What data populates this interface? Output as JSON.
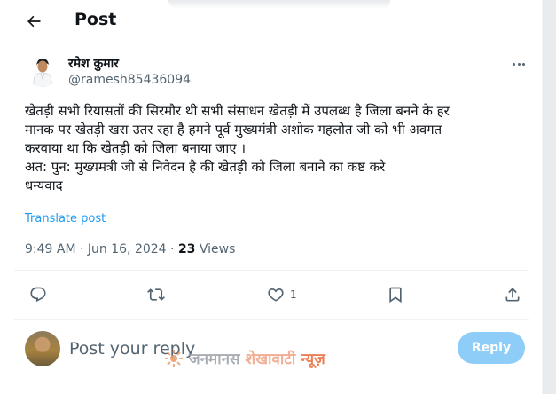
{
  "header": {
    "title": "Post",
    "back_icon": "arrow-left-icon"
  },
  "author": {
    "name": "रमेश कुमार",
    "handle": "@ramesh85436094",
    "avatar_icon": "user-avatar"
  },
  "post": {
    "lines": [
      "खेतड़ी सभी रियासतों की सिरमौर थी सभी संसाधन खेतड़ी में उपलब्ध है जिला बनने के हर",
      "मानक पर खेतड़ी खरा उतर रहा है हमने पूर्व मुख्यमंत्री अशोक गहलोत जी को भी अवगत",
      "करवाया था कि खेतड़ी को जिला बनाया जाए ।",
      "अत: पुन: मुख्यमत्री जी से निवेदन है की खेतड़ी को जिला बनाने का कष्ट करे",
      "धन्यवाद"
    ],
    "translate_label": "Translate post",
    "time": "9:49 AM",
    "date": "Jun 16, 2024",
    "views_count": "23",
    "views_label": "Views"
  },
  "actions": {
    "reply_icon": "reply-icon",
    "repost_icon": "repost-icon",
    "like_icon": "heart-icon",
    "like_count": "1",
    "bookmark_icon": "bookmark-icon",
    "share_icon": "share-icon"
  },
  "composer": {
    "placeholder": "Post your reply",
    "button_label": "Reply"
  },
  "watermark": {
    "word1": "जनमानस",
    "word2": "शेखावाटी",
    "word3": "न्यूज़"
  },
  "colors": {
    "accent": "#1d9bf0",
    "reply_button_bg": "#8ecdf8",
    "secondary_text": "#536471",
    "primary_text": "#0f1419",
    "divider": "#eff3f4"
  }
}
